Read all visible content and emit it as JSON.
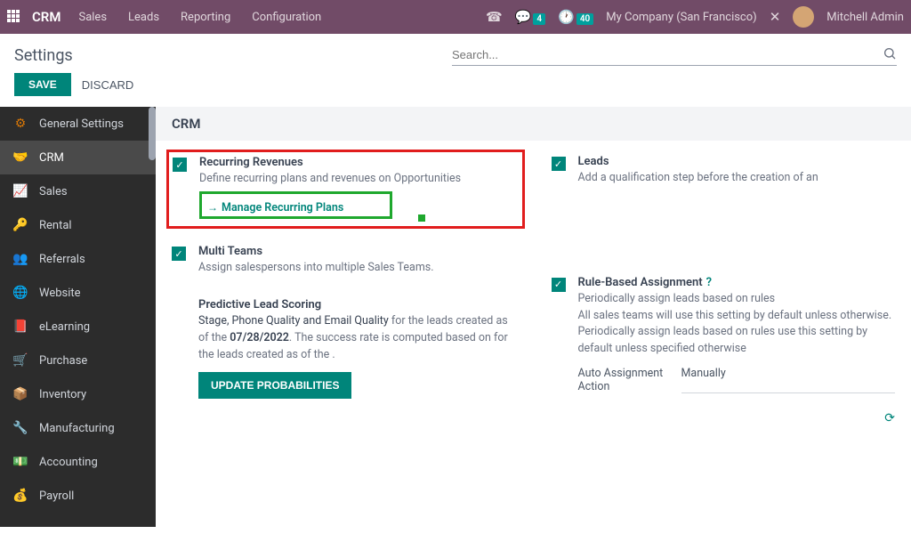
{
  "topbar": {
    "brand": "CRM",
    "nav": [
      "Sales",
      "Leads",
      "Reporting",
      "Configuration"
    ],
    "messages_badge": "4",
    "activities_badge": "40",
    "company": "My Company (San Francisco)",
    "user": "Mitchell Admin"
  },
  "page": {
    "title": "Settings",
    "search_placeholder": "Search...",
    "save_label": "SAVE",
    "discard_label": "DISCARD"
  },
  "sidebar": {
    "items": [
      {
        "label": "General Settings"
      },
      {
        "label": "CRM"
      },
      {
        "label": "Sales"
      },
      {
        "label": "Rental"
      },
      {
        "label": "Referrals"
      },
      {
        "label": "Website"
      },
      {
        "label": "eLearning"
      },
      {
        "label": "Purchase"
      },
      {
        "label": "Inventory"
      },
      {
        "label": "Manufacturing"
      },
      {
        "label": "Accounting"
      },
      {
        "label": "Payroll"
      }
    ],
    "active_index": 1
  },
  "content": {
    "section_title": "CRM",
    "recurring": {
      "title": "Recurring Revenues",
      "desc": "Define recurring plans and revenues on Opportunities",
      "link": "Manage Recurring Plans"
    },
    "leads": {
      "title": "Leads",
      "desc": "Add a qualification step before the creation of an"
    },
    "multi_teams": {
      "title": "Multi Teams",
      "desc": "Assign salespersons into multiple Sales Teams."
    },
    "predictive": {
      "title": "Predictive Lead Scoring",
      "desc_prefix": "Stage, Phone Quality and Email Quality",
      "desc_middle": " for the leads created as of the ",
      "desc_date": "07/28/2022",
      "desc_suffix": ". The success rate is computed based on for the leads created as of the .",
      "button": "UPDATE PROBABILITIES"
    },
    "rule_based": {
      "title": "Rule-Based Assignment",
      "desc": "Periodically assign leads based on rules",
      "desc2": "All sales teams will use this setting by default unless otherwise. Periodically assign leads based on rules use this setting by default unless specified otherwise",
      "field_label": "Auto Assignment Action",
      "field_value": "Manually"
    }
  }
}
